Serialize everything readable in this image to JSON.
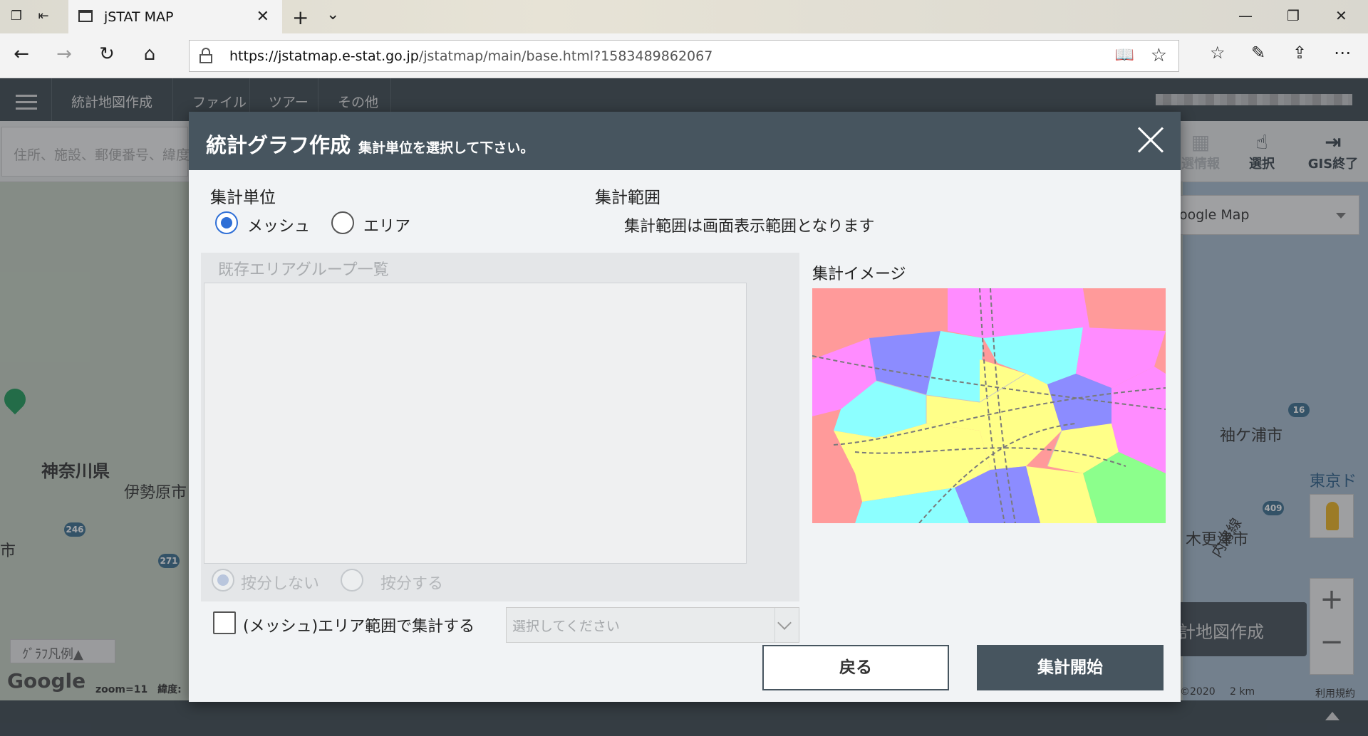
{
  "browser": {
    "tab_title": "jSTAT MAP",
    "url_origin": "https://jstatmap.e-stat.go.jp",
    "url_path": "/jstatmap/main/base.html?1583489862067"
  },
  "app": {
    "menu": [
      "統計地図作成",
      "ファイル",
      "ツアー",
      "その他"
    ],
    "search_placeholder": "住所、施設、郵便番号、緯度",
    "tools": [
      "選情報",
      "選択",
      "GIS終了"
    ],
    "map_type": "oogle Map",
    "create_map_button": "計地図作成",
    "legend_button": "ｸﾞﾗﾌ凡例▲",
    "zoom_text": "zoom=11",
    "lat_text": "緯度:",
    "attribution_year": "©2020",
    "scale": "2 km",
    "terms": "利用規約",
    "google": "Google"
  },
  "map_labels": {
    "kanagawa": "神奈川県",
    "isehara": "伊勢原市",
    "city_left": "市",
    "sodegaura": "袖ケ浦市",
    "kisarazu": "木更津市",
    "uchibo": "内房線",
    "tokyo": "東京ド",
    "r246": "246",
    "r271": "271",
    "r16": "16",
    "r409": "409"
  },
  "modal": {
    "title": "統計グラフ作成",
    "subtitle": "集計単位を選択して下さい。",
    "unit_label": "集計単位",
    "unit_options": [
      "メッシュ",
      "エリア"
    ],
    "unit_selected": "メッシュ",
    "range_label": "集計範囲",
    "range_text": "集計範囲は画面表示範囲となります",
    "group_list_title": "既存エリアグループ一覧",
    "apportion_options": [
      "按分しない",
      "按分する"
    ],
    "checkbox_label": "(メッシュ)エリア範囲で集計する",
    "select_placeholder": "選択してください",
    "preview_label": "集計イメージ",
    "back_button": "戻る",
    "start_button": "集計開始"
  },
  "colors": {
    "header": "#47555f",
    "accent_radio": "#2f6fd6",
    "preview_regions": [
      "#ff9a9a",
      "#ff8cff",
      "#8cffff",
      "#ffff88",
      "#8c8cff",
      "#8cff8c"
    ]
  }
}
